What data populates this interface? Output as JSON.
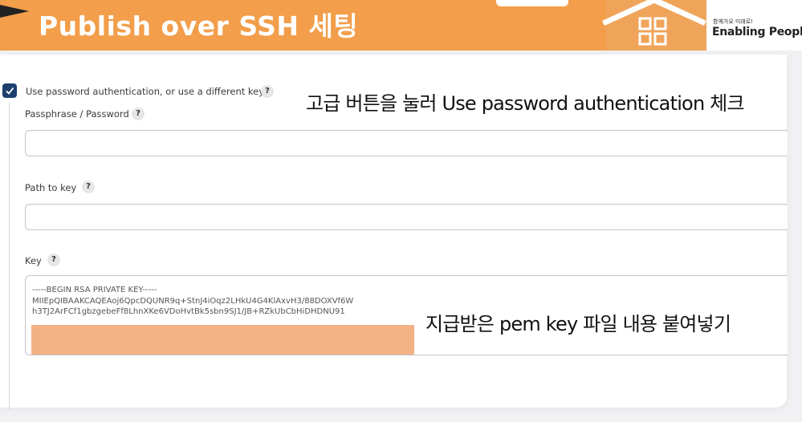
{
  "banner": {
    "title": "Publish over SSH 세팅",
    "brand_tagline": "함께가요 미래로!",
    "brand_name": "Enabling People"
  },
  "form": {
    "use_password_auth": {
      "label": "Use password authentication, or use a different key",
      "checked": true,
      "help": "?"
    },
    "passphrase": {
      "label": "Passphrase / Password",
      "help": "?",
      "value": ""
    },
    "path_to_key": {
      "label": "Path to key",
      "help": "?",
      "value": ""
    },
    "key": {
      "label": "Key",
      "help": "?",
      "value": "-----BEGIN RSA PRIVATE KEY-----\nMIIEpQIBAAKCAQEAoj6QpcDQUNR9q+StnJ4iOqz2LHkU4G4KlAxvH3/88DOXVf6W\nh3TJ2ArFCf1gbzgebeFf8LhnXKe6VDoHvtBk5sbn9SJ1/JB+RZkUbCbHiDHDNU91"
    }
  },
  "annotations": {
    "top": "고급 버튼을 눌러 Use password authentication 체크",
    "key": "지급받은 pem key 파일 내용 붙여넣기"
  },
  "colors": {
    "banner": "#f29e4a",
    "checkbox": "#1c3f6e",
    "redaction": "#f3b286"
  }
}
